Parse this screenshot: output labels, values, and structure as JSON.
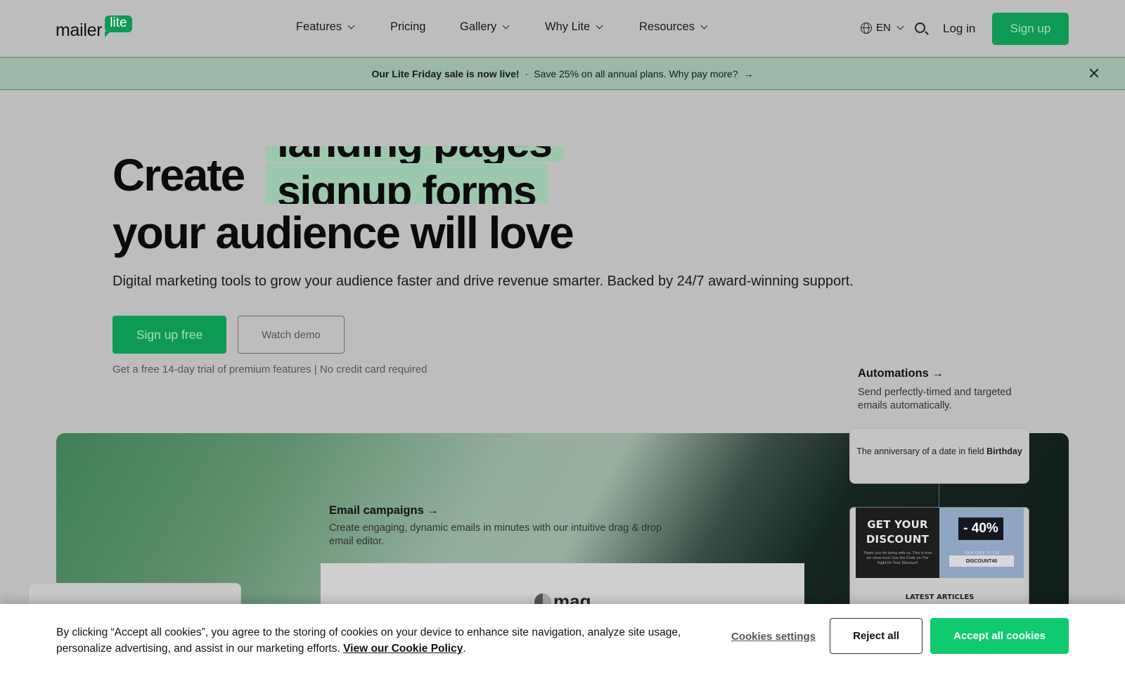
{
  "header": {
    "logo": {
      "text": "mailer",
      "badge": "lite"
    },
    "nav": [
      {
        "label": "Features",
        "has_dropdown": true
      },
      {
        "label": "Pricing",
        "has_dropdown": false
      },
      {
        "label": "Gallery",
        "has_dropdown": true
      },
      {
        "label": "Why Lite",
        "has_dropdown": true
      },
      {
        "label": "Resources",
        "has_dropdown": true
      }
    ],
    "language": "EN",
    "login_label": "Log in",
    "signup_label": "Sign up"
  },
  "promo": {
    "bold": "Our Lite Friday sale is now live!",
    "separator": "·",
    "text": "Save 25% on all annual plans. Why pay more?",
    "arrow": "→"
  },
  "hero": {
    "create": "Create",
    "rotating_words": [
      "landing pages",
      "signup forms"
    ],
    "line2": "your audience will love",
    "subtitle": "Digital marketing tools to grow your audience faster and drive revenue smarter. Backed by 24/7 award-winning support.",
    "primary_cta": "Sign up free",
    "secondary_cta": "Watch demo",
    "note": "Get a free 14-day trial of premium features | No credit card required"
  },
  "features": {
    "email": {
      "title": "Email campaigns →",
      "desc": "Create engaging, dynamic emails in minutes with our intuitive drag & drop email editor."
    },
    "automations": {
      "title": "Automations →",
      "desc": "Send perfectly-timed and targeted emails automatically."
    },
    "editor_logo": "mag",
    "trigger": {
      "prefix": "The anniversary of a date in field ",
      "field": "Birthday"
    },
    "email_preview": {
      "headline_1": "GET YOUR",
      "headline_2": "DISCOUNT",
      "fine_print": "Thank you for being with us. This is how we show love! Use the Code on The Right for Your Discount!",
      "badge": "- 40%",
      "code_label": "YOUR CODE TO USE",
      "code": "DISCOUNT40",
      "articles": "LATEST ARTICLES"
    }
  },
  "cookie": {
    "text": "By clicking “Accept all cookies”, you agree to the storing of cookies on your device to enhance site navigation, analyze site usage, personalize advertising, and assist in our marketing efforts.",
    "policy_link": "View our Cookie Policy",
    "period": ".",
    "settings_label": "Cookies settings",
    "reject_label": "Reject all",
    "accept_label": "Accept all cookies"
  },
  "colors": {
    "brand_green": "#0e9a55",
    "accept_green": "#0fcb6d",
    "highlight": "#9cc8ae",
    "promo_bg": "#9db8a9"
  }
}
